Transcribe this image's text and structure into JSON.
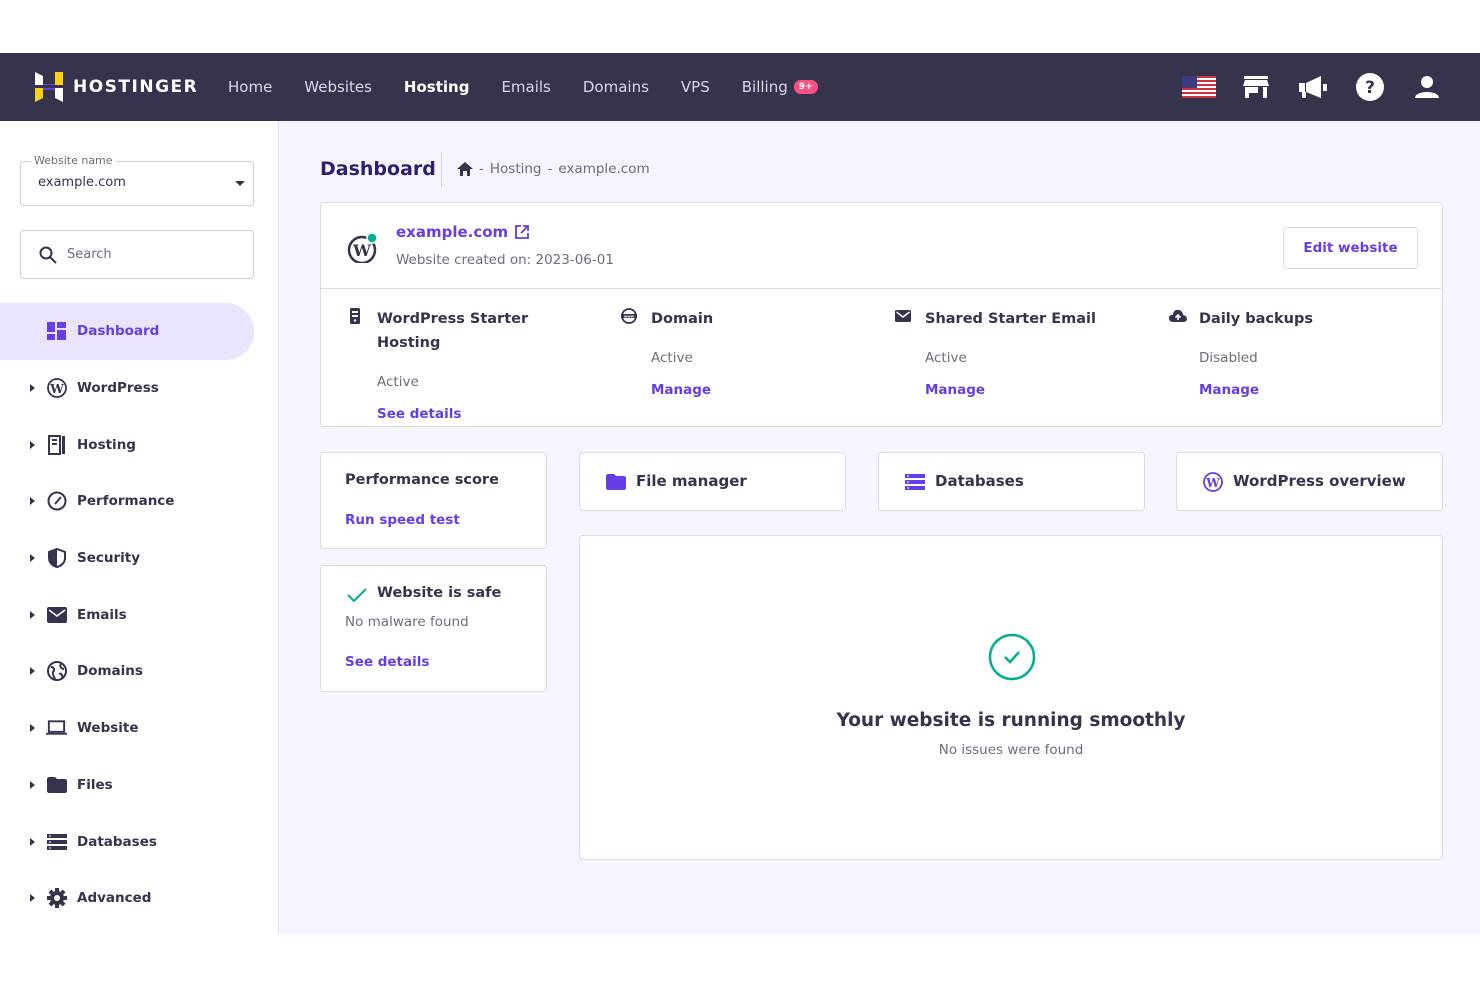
{
  "topnav": {
    "brand": "HOSTINGER",
    "links": [
      {
        "label": "Home"
      },
      {
        "label": "Websites"
      },
      {
        "label": "Hosting",
        "active": true
      },
      {
        "label": "Emails"
      },
      {
        "label": "Domains"
      },
      {
        "label": "VPS"
      },
      {
        "label": "Billing",
        "badge": "9+"
      }
    ],
    "icons": [
      "us-flag-icon",
      "store-icon",
      "megaphone-icon",
      "help-icon",
      "user-icon"
    ]
  },
  "sidebar": {
    "website_select": {
      "legend": "Website name",
      "value": "example.com"
    },
    "search": {
      "placeholder": "Search"
    },
    "items": [
      {
        "label": "Dashboard",
        "icon": "dashboard-icon",
        "active": true
      },
      {
        "label": "WordPress",
        "icon": "wordpress-icon"
      },
      {
        "label": "Hosting",
        "icon": "hosting-icon"
      },
      {
        "label": "Performance",
        "icon": "speedometer-icon"
      },
      {
        "label": "Security",
        "icon": "shield-icon"
      },
      {
        "label": "Emails",
        "icon": "envelope-icon"
      },
      {
        "label": "Domains",
        "icon": "globe-icon"
      },
      {
        "label": "Website",
        "icon": "laptop-icon"
      },
      {
        "label": "Files",
        "icon": "folder-icon"
      },
      {
        "label": "Databases",
        "icon": "database-icon"
      },
      {
        "label": "Advanced",
        "icon": "gear-icon"
      }
    ]
  },
  "main": {
    "title": "Dashboard",
    "breadcrumb": [
      "Hosting",
      "example.com"
    ],
    "site": {
      "domain": "example.com",
      "created": "Website created on: 2023-06-01",
      "edit_label": "Edit website"
    },
    "services": [
      {
        "name": "WordPress Starter Hosting",
        "status": "Active",
        "link": "See details",
        "icon": "server-icon"
      },
      {
        "name": "Domain",
        "status": "Active",
        "link": "Manage",
        "icon": "www-globe-icon"
      },
      {
        "name": "Shared Starter Email",
        "status": "Active",
        "link": "Manage",
        "icon": "envelope-icon"
      },
      {
        "name": "Daily backups",
        "status": "Disabled",
        "link": "Manage",
        "icon": "cloud-upload-icon"
      }
    ],
    "performance": {
      "title": "Performance score",
      "link": "Run speed test"
    },
    "security": {
      "title": "Website is safe",
      "text": "No malware found",
      "link": "See details"
    },
    "quick_links": [
      {
        "label": "File manager",
        "icon": "folder-icon"
      },
      {
        "label": "Databases",
        "icon": "database-icon"
      },
      {
        "label": "WordPress overview",
        "icon": "wordpress-icon"
      }
    ],
    "status": {
      "title": "Your website is running smoothly",
      "subtitle": "No issues were found"
    }
  },
  "colors": {
    "nav_bg": "#36344d",
    "accent": "#673de6",
    "success": "#00b090",
    "badge": "#fc5185",
    "page_bg": "#f4f5ff"
  }
}
